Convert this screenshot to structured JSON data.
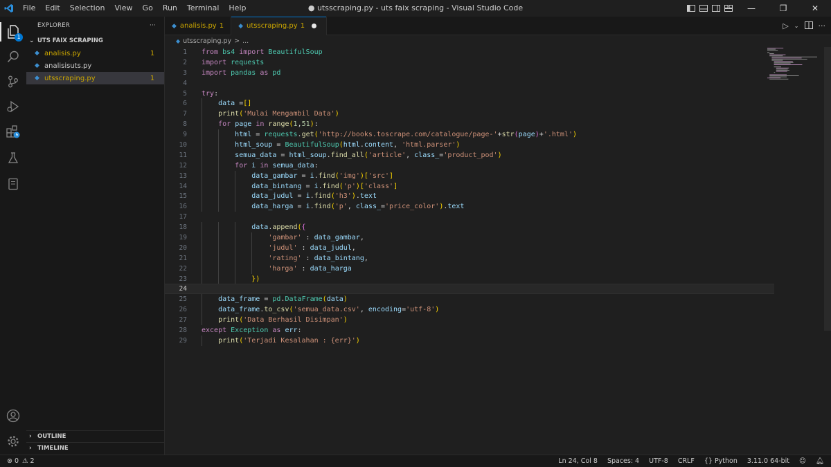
{
  "titlebar": {
    "menu": [
      "File",
      "Edit",
      "Selection",
      "View",
      "Go",
      "Run",
      "Terminal",
      "Help"
    ],
    "window_title": "● utsscraping.py - uts faix scraping - Visual Studio Code"
  },
  "activity": {
    "explorer_badge": "1"
  },
  "sidebar": {
    "title": "EXPLORER",
    "more": "···",
    "folder": "UTS FAIX SCRAPING",
    "files": [
      {
        "name": "analisis.py",
        "count": "1",
        "warn": true
      },
      {
        "name": "analisisuts.py",
        "count": "",
        "warn": false
      },
      {
        "name": "utsscraping.py",
        "count": "1",
        "warn": true
      }
    ],
    "outline": "OUTLINE",
    "timeline": "TIMELINE"
  },
  "tabs": [
    {
      "name": "analisis.py",
      "badge": "1"
    },
    {
      "name": "utsscraping.py",
      "badge": "1"
    }
  ],
  "breadcrumb": {
    "file": "utsscraping.py",
    "sep": ">",
    "rest": "..."
  },
  "code": {
    "current_line": 24,
    "lines": [
      "from bs4 import BeautifulSoup",
      "import requests",
      "import pandas as pd",
      "",
      "try:",
      "    data =[]",
      "    print('Mulai Mengambil Data')",
      "    for page in range(1,51):",
      "        html = requests.get('http://books.toscrape.com/catalogue/page-'+str(page)+'.html')",
      "        html_soup = BeautifulSoup(html.content, 'html.parser')",
      "        semua_data = html_soup.find_all('article', class_='product_pod')",
      "        for i in semua_data:",
      "            data_gambar = i.find('img')['src']",
      "            data_bintang = i.find('p')['class']",
      "            data_judul = i.find('h3').text",
      "            data_harga = i.find('p', class_='price_color').text",
      "",
      "            data.append({",
      "                'gambar' : data_gambar,",
      "                'judul' : data_judul,",
      "                'rating' : data_bintang,",
      "                'harga' : data_harga",
      "            })",
      "",
      "    data_frame = pd.DataFrame(data)",
      "    data_frame.to_csv('semua_data.csv', encoding='utf-8')",
      "    print('Data Berhasil Disimpan')",
      "except Exception as err:",
      "    print('Terjadi Kesalahan : {err}')"
    ]
  },
  "status": {
    "errors": "0",
    "warnings": "2",
    "position": "Ln 24, Col 8",
    "spaces": "Spaces: 4",
    "encoding": "UTF-8",
    "eol": "CRLF",
    "language": "Python",
    "interpreter": "3.11.0 64-bit"
  },
  "colors": {
    "accent": "#0078d4",
    "warning": "#cca700",
    "keyword": "#c586c0",
    "string": "#ce9178",
    "function": "#dcdcaa",
    "variable": "#9cdcfe"
  }
}
